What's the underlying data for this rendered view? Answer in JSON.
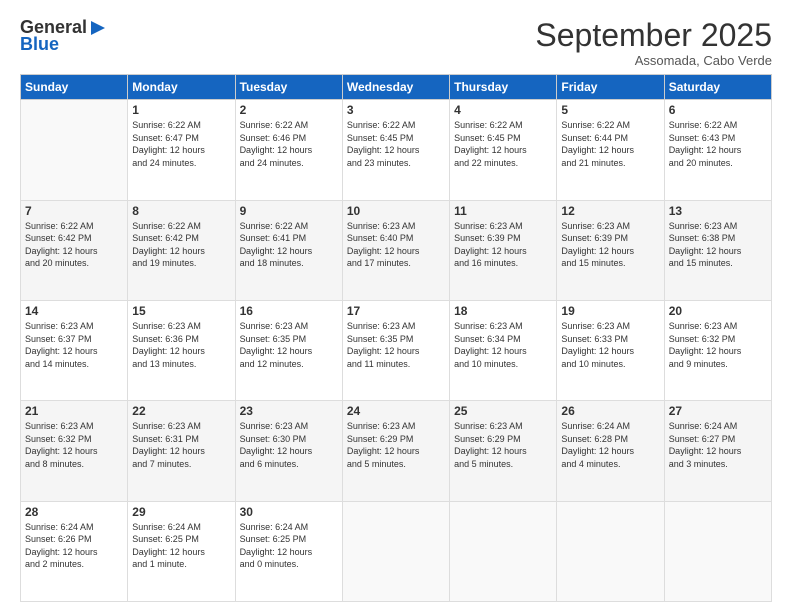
{
  "logo": {
    "general": "General",
    "blue": "Blue"
  },
  "header": {
    "month": "September 2025",
    "location": "Assomada, Cabo Verde"
  },
  "weekdays": [
    "Sunday",
    "Monday",
    "Tuesday",
    "Wednesday",
    "Thursday",
    "Friday",
    "Saturday"
  ],
  "weeks": [
    [
      {
        "day": "",
        "info": ""
      },
      {
        "day": "1",
        "info": "Sunrise: 6:22 AM\nSunset: 6:47 PM\nDaylight: 12 hours\nand 24 minutes."
      },
      {
        "day": "2",
        "info": "Sunrise: 6:22 AM\nSunset: 6:46 PM\nDaylight: 12 hours\nand 24 minutes."
      },
      {
        "day": "3",
        "info": "Sunrise: 6:22 AM\nSunset: 6:45 PM\nDaylight: 12 hours\nand 23 minutes."
      },
      {
        "day": "4",
        "info": "Sunrise: 6:22 AM\nSunset: 6:45 PM\nDaylight: 12 hours\nand 22 minutes."
      },
      {
        "day": "5",
        "info": "Sunrise: 6:22 AM\nSunset: 6:44 PM\nDaylight: 12 hours\nand 21 minutes."
      },
      {
        "day": "6",
        "info": "Sunrise: 6:22 AM\nSunset: 6:43 PM\nDaylight: 12 hours\nand 20 minutes."
      }
    ],
    [
      {
        "day": "7",
        "info": "Sunrise: 6:22 AM\nSunset: 6:42 PM\nDaylight: 12 hours\nand 20 minutes."
      },
      {
        "day": "8",
        "info": "Sunrise: 6:22 AM\nSunset: 6:42 PM\nDaylight: 12 hours\nand 19 minutes."
      },
      {
        "day": "9",
        "info": "Sunrise: 6:22 AM\nSunset: 6:41 PM\nDaylight: 12 hours\nand 18 minutes."
      },
      {
        "day": "10",
        "info": "Sunrise: 6:23 AM\nSunset: 6:40 PM\nDaylight: 12 hours\nand 17 minutes."
      },
      {
        "day": "11",
        "info": "Sunrise: 6:23 AM\nSunset: 6:39 PM\nDaylight: 12 hours\nand 16 minutes."
      },
      {
        "day": "12",
        "info": "Sunrise: 6:23 AM\nSunset: 6:39 PM\nDaylight: 12 hours\nand 15 minutes."
      },
      {
        "day": "13",
        "info": "Sunrise: 6:23 AM\nSunset: 6:38 PM\nDaylight: 12 hours\nand 15 minutes."
      }
    ],
    [
      {
        "day": "14",
        "info": "Sunrise: 6:23 AM\nSunset: 6:37 PM\nDaylight: 12 hours\nand 14 minutes."
      },
      {
        "day": "15",
        "info": "Sunrise: 6:23 AM\nSunset: 6:36 PM\nDaylight: 12 hours\nand 13 minutes."
      },
      {
        "day": "16",
        "info": "Sunrise: 6:23 AM\nSunset: 6:35 PM\nDaylight: 12 hours\nand 12 minutes."
      },
      {
        "day": "17",
        "info": "Sunrise: 6:23 AM\nSunset: 6:35 PM\nDaylight: 12 hours\nand 11 minutes."
      },
      {
        "day": "18",
        "info": "Sunrise: 6:23 AM\nSunset: 6:34 PM\nDaylight: 12 hours\nand 10 minutes."
      },
      {
        "day": "19",
        "info": "Sunrise: 6:23 AM\nSunset: 6:33 PM\nDaylight: 12 hours\nand 10 minutes."
      },
      {
        "day": "20",
        "info": "Sunrise: 6:23 AM\nSunset: 6:32 PM\nDaylight: 12 hours\nand 9 minutes."
      }
    ],
    [
      {
        "day": "21",
        "info": "Sunrise: 6:23 AM\nSunset: 6:32 PM\nDaylight: 12 hours\nand 8 minutes."
      },
      {
        "day": "22",
        "info": "Sunrise: 6:23 AM\nSunset: 6:31 PM\nDaylight: 12 hours\nand 7 minutes."
      },
      {
        "day": "23",
        "info": "Sunrise: 6:23 AM\nSunset: 6:30 PM\nDaylight: 12 hours\nand 6 minutes."
      },
      {
        "day": "24",
        "info": "Sunrise: 6:23 AM\nSunset: 6:29 PM\nDaylight: 12 hours\nand 5 minutes."
      },
      {
        "day": "25",
        "info": "Sunrise: 6:23 AM\nSunset: 6:29 PM\nDaylight: 12 hours\nand 5 minutes."
      },
      {
        "day": "26",
        "info": "Sunrise: 6:24 AM\nSunset: 6:28 PM\nDaylight: 12 hours\nand 4 minutes."
      },
      {
        "day": "27",
        "info": "Sunrise: 6:24 AM\nSunset: 6:27 PM\nDaylight: 12 hours\nand 3 minutes."
      }
    ],
    [
      {
        "day": "28",
        "info": "Sunrise: 6:24 AM\nSunset: 6:26 PM\nDaylight: 12 hours\nand 2 minutes."
      },
      {
        "day": "29",
        "info": "Sunrise: 6:24 AM\nSunset: 6:25 PM\nDaylight: 12 hours\nand 1 minute."
      },
      {
        "day": "30",
        "info": "Sunrise: 6:24 AM\nSunset: 6:25 PM\nDaylight: 12 hours\nand 0 minutes."
      },
      {
        "day": "",
        "info": ""
      },
      {
        "day": "",
        "info": ""
      },
      {
        "day": "",
        "info": ""
      },
      {
        "day": "",
        "info": ""
      }
    ]
  ]
}
